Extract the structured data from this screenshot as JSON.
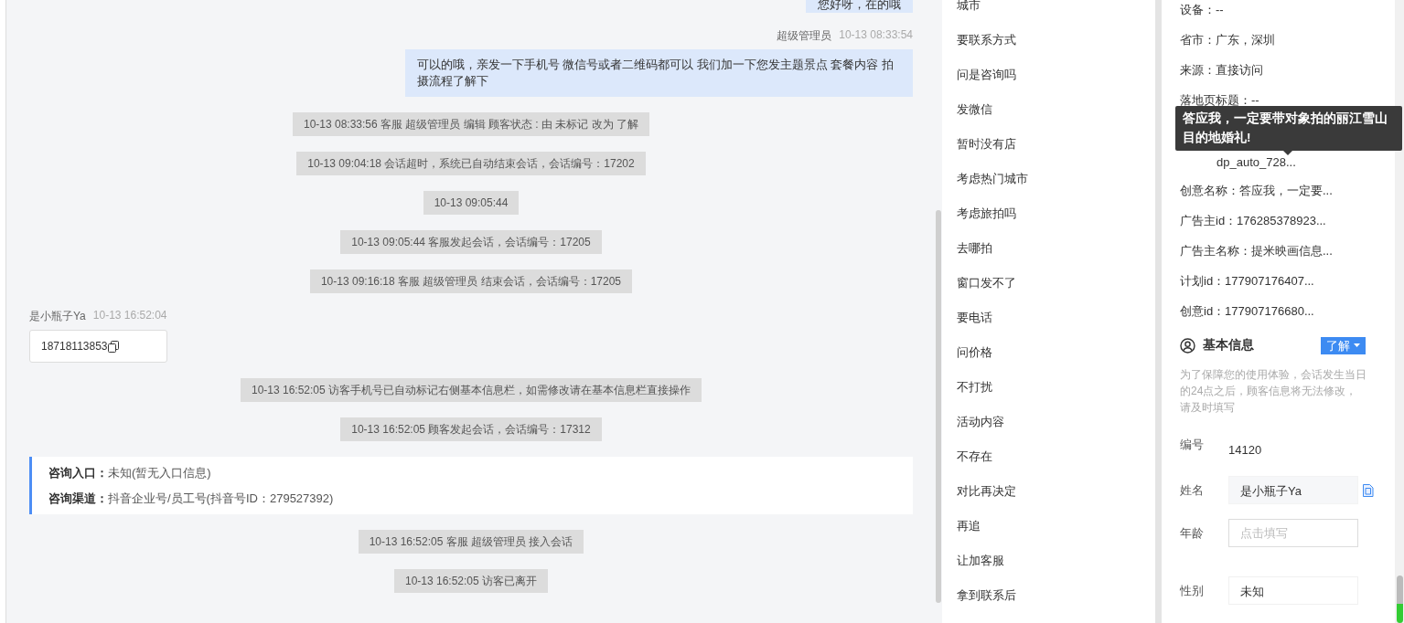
{
  "chat": {
    "messages": [
      {
        "kind": "agent_short",
        "text": "您好呀，在的哦"
      },
      {
        "kind": "agent",
        "sender": "超级管理员",
        "time": "10-13 08:33:54",
        "text": "可以的哦，亲发一下手机号 微信号或者二维码都可以 我们加一下您发主题景点 套餐内容 拍摄流程了解下"
      },
      {
        "kind": "system",
        "text": "10-13 08:33:56 客服 超级管理员 编辑 顾客状态 : 由 未标记 改为 了解"
      },
      {
        "kind": "system",
        "text": "10-13 09:04:18 会话超时，系统已自动结束会话，会话编号：17202"
      },
      {
        "kind": "system",
        "text": "10-13 09:05:44"
      },
      {
        "kind": "system",
        "text": "10-13 09:05:44 客服发起会话，会话编号：17205"
      },
      {
        "kind": "system",
        "text": "10-13 09:16:18 客服 超级管理员 结束会话，会话编号：17205"
      },
      {
        "kind": "visitor",
        "sender": "是小瓶子Ya",
        "time": "10-13 16:52:04",
        "text": "18718113853"
      },
      {
        "kind": "system",
        "text": "10-13 16:52:05 访客手机号已自动标记右侧基本信息栏，如需修改请在基本信息栏直接操作"
      },
      {
        "kind": "system",
        "text": "10-13 16:52:05 顾客发起会话，会话编号：17312"
      },
      {
        "kind": "info",
        "rows": [
          {
            "label": "咨询入口：",
            "value": "未知(暂无入口信息)"
          },
          {
            "label": "咨询渠道：",
            "value": "抖音企业号/员工号(抖音号ID：279527392)"
          }
        ]
      },
      {
        "kind": "system",
        "text": "10-13 16:52:05 客服 超级管理员 接入会话"
      },
      {
        "kind": "system",
        "text": "10-13 16:52:05 访客已离开"
      }
    ]
  },
  "quick_replies": [
    "城市",
    "要联系方式",
    "问是咨询吗",
    "发微信",
    "暂时没有店",
    "考虑热门城市",
    "考虑旅拍吗",
    "去哪拍",
    "窗口发不了",
    "要电话",
    "问价格",
    "不打扰",
    "活动内容",
    "不存在",
    "对比再决定",
    "再追",
    "让加客服",
    "拿到联系后"
  ],
  "source_info": {
    "rows": [
      {
        "kind": "row",
        "text": "设备：--"
      },
      {
        "kind": "row",
        "text": "省市：广东，深圳"
      },
      {
        "kind": "row",
        "text": "来源：直接访问"
      },
      {
        "kind": "row",
        "text": "落地页标题：--"
      },
      {
        "kind": "tooltip",
        "text": "答应我，一定要带对象拍的丽江雪山目的地婚礼!"
      },
      {
        "kind": "partial",
        "value": "dp_auto_728..."
      },
      {
        "kind": "row",
        "text": "创意名称：答应我，一定要..."
      },
      {
        "kind": "row",
        "text": "广告主id：176285378923..."
      },
      {
        "kind": "row",
        "text": "广告主名称：提米映画信息..."
      },
      {
        "kind": "row",
        "text": "计划id：177907176407..."
      },
      {
        "kind": "row",
        "text": "创意id：177907176680..."
      }
    ]
  },
  "basic_info": {
    "title": "基本信息",
    "status": "了解",
    "notice": "为了保障您的使用体验，会话发生当日的24点之后，顾客信息将无法修改，请及时填写",
    "fields": [
      {
        "kind": "readonly",
        "label": "编号",
        "value": "14120"
      },
      {
        "kind": "copyable",
        "label": "姓名",
        "value": "是小瓶子Ya"
      },
      {
        "kind": "input",
        "label": "年龄",
        "placeholder": "点击填写"
      },
      {
        "kind": "text",
        "label": "性别",
        "value": "未知"
      }
    ]
  }
}
